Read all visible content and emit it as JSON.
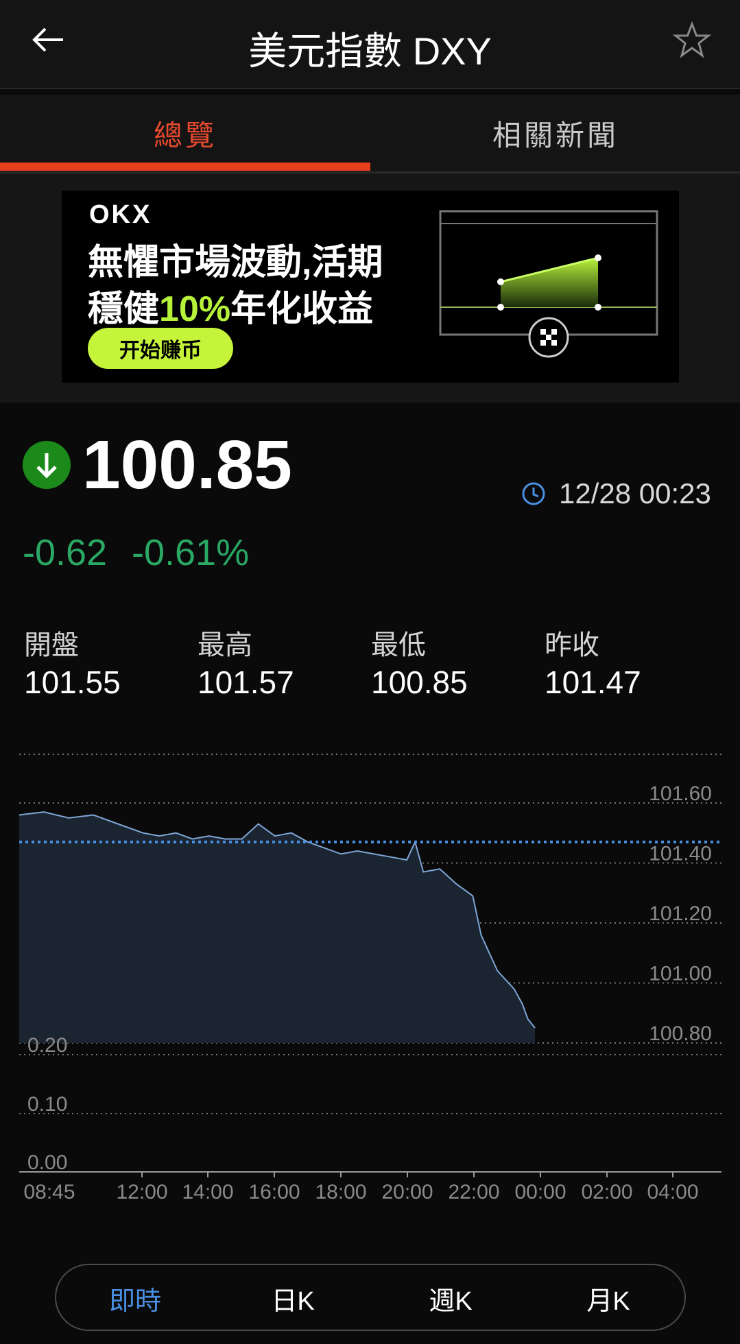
{
  "header": {
    "title": "美元指數 DXY",
    "back_icon": "back-arrow-icon",
    "favorite_icon": "star-outline-icon"
  },
  "tabs": [
    {
      "label": "總覽",
      "active": true
    },
    {
      "label": "相關新聞",
      "active": false
    }
  ],
  "ad": {
    "logo": "OKX",
    "line1": "無懼市場波動,活期",
    "line2_prefix": "穩健",
    "line2_highlight": "10%",
    "line2_suffix": "年化收益",
    "cta": "开始赚币",
    "colors": {
      "highlight": "#b6f23a",
      "cta_bg": "#c5f43b"
    }
  },
  "quote": {
    "direction_icon": "down-arrow-circle-icon",
    "price": "100.85",
    "change": "-0.62",
    "change_pct": "-0.61%",
    "time_icon": "clock-icon",
    "timestamp": "12/28 00:23",
    "colors": {
      "down": "#2aa864",
      "icon_bg": "#1c8a1a"
    }
  },
  "stats": [
    {
      "label": "開盤",
      "value": "101.55"
    },
    {
      "label": "最高",
      "value": "101.57"
    },
    {
      "label": "最低",
      "value": "100.85"
    },
    {
      "label": "昨收",
      "value": "101.47"
    }
  ],
  "chart_data": {
    "type": "area",
    "title": "",
    "xlabel": "",
    "ylabel": "",
    "x_ticks": [
      "08:45",
      "12:00",
      "14:00",
      "16:00",
      "18:00",
      "20:00",
      "22:00",
      "00:00",
      "02:00",
      "04:00"
    ],
    "y_ticks": [
      "101.60",
      "101.40",
      "101.20",
      "101.00",
      "100.80"
    ],
    "ylim": [
      100.8,
      101.6
    ],
    "reference_line": {
      "name": "昨收",
      "value": 101.47
    },
    "volume_ticks": [
      "0.20",
      "0.10",
      "0.00"
    ],
    "series": [
      {
        "x": [
          "08:45",
          "09:30",
          "10:15",
          "11:00",
          "12:00",
          "12:30",
          "13:00",
          "13:30",
          "14:00",
          "14:30",
          "15:00",
          "15:30",
          "16:00",
          "16:15",
          "16:30",
          "17:00",
          "17:30",
          "18:00",
          "18:30",
          "19:00",
          "19:30",
          "20:00",
          "20:30",
          "20:45",
          "21:00",
          "21:30",
          "22:00",
          "22:30",
          "22:45",
          "23:00",
          "23:15",
          "23:30",
          "23:45",
          "00:00",
          "00:10",
          "00:23"
        ],
        "values": [
          101.56,
          101.57,
          101.55,
          101.56,
          101.52,
          101.5,
          101.49,
          101.5,
          101.48,
          101.49,
          101.48,
          101.48,
          101.53,
          101.51,
          101.49,
          101.5,
          101.47,
          101.45,
          101.43,
          101.44,
          101.43,
          101.42,
          101.41,
          101.47,
          101.37,
          101.38,
          101.33,
          101.29,
          101.16,
          101.1,
          101.04,
          101.01,
          100.98,
          100.93,
          100.88,
          100.85
        ]
      }
    ],
    "colors": {
      "line": "#7ea6d6",
      "fill": "#1b2431",
      "reference": "#4a90e2",
      "grid": "#777777"
    }
  },
  "periods": [
    {
      "label": "即時",
      "active": true
    },
    {
      "label": "日K",
      "active": false
    },
    {
      "label": "週K",
      "active": false
    },
    {
      "label": "月K",
      "active": false
    }
  ]
}
